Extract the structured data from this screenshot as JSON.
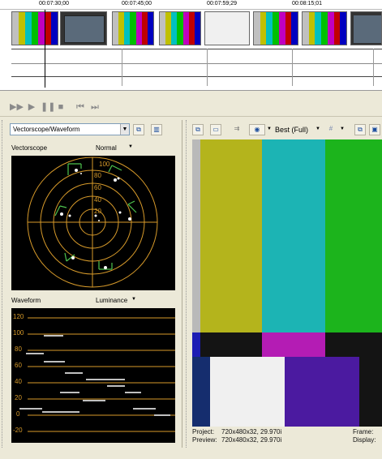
{
  "timeline": {
    "ruler": [
      "00:07:30;00",
      "00:07:45;00",
      "00:07:59;29",
      "00:08:15;01"
    ]
  },
  "scopes": {
    "selector_value": "Vectorscope/Waveform",
    "vectorscope_label": "Vectorscope",
    "vectorscope_mode": "Normal",
    "vectorscope_scale": [
      "100",
      "80",
      "60",
      "40",
      "20"
    ],
    "waveform_label": "Waveform",
    "waveform_mode": "Luminance",
    "waveform_scale": [
      "120",
      "100",
      "80",
      "60",
      "40",
      "20",
      "0",
      "-20"
    ]
  },
  "preview": {
    "quality": "Best (Full)",
    "project_label": "Project:",
    "project_value": "720x480x32, 29.970i",
    "preview_label": "Preview:",
    "preview_value": "720x480x32, 29.970i",
    "frame_label": "Frame:",
    "display_label": "Display:"
  },
  "colors": {
    "bar_yellow": "#b4b41c",
    "bar_cyan": "#1cb4b4",
    "bar_green": "#1cb41c",
    "bar_magenta": "#b41cb4",
    "bar_blue": "#1c1cb4",
    "scope_grid": "#d79a2a"
  }
}
